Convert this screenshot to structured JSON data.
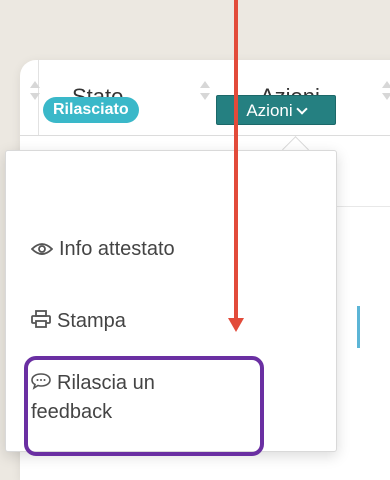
{
  "table": {
    "columns": [
      {
        "label": "Stato"
      },
      {
        "label": "Azioni"
      }
    ],
    "row": {
      "status_badge": "Rilasciato",
      "actions_button": "Azioni"
    }
  },
  "dropdown": {
    "items": [
      {
        "label": "Info attestato",
        "icon": "eye-icon"
      },
      {
        "label": "Stampa",
        "icon": "printer-icon"
      },
      {
        "label": "Rilascia un feedback",
        "label_line1": "Rilascia un",
        "label_line2": "feedback",
        "icon": "comment-icon"
      }
    ]
  },
  "colors": {
    "badge": "#3ab8c9",
    "button": "#258081",
    "arrow": "#e24b3a",
    "highlight": "#6a2fa2"
  }
}
